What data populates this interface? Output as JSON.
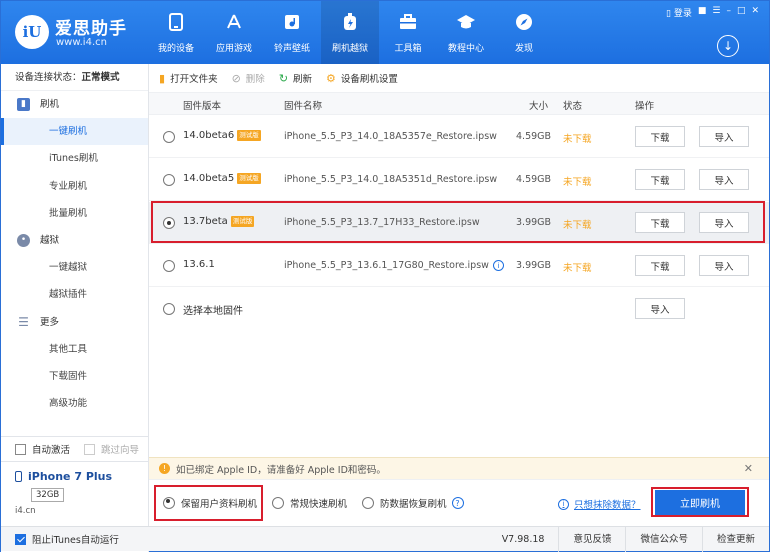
{
  "header": {
    "logo_text": "iU",
    "brand": "爱思助手",
    "site": "www.i4.cn",
    "nav": [
      {
        "label": "我的设备",
        "icon": "phone-icon"
      },
      {
        "label": "应用游戏",
        "icon": "apps-icon"
      },
      {
        "label": "铃声壁纸",
        "icon": "music-icon"
      },
      {
        "label": "刷机越狱",
        "icon": "flash-icon",
        "active": true
      },
      {
        "label": "工具箱",
        "icon": "toolbox-icon"
      },
      {
        "label": "教程中心",
        "icon": "tutorial-icon"
      },
      {
        "label": "发现",
        "icon": "discover-icon"
      }
    ],
    "win_login": "登录"
  },
  "sidebar": {
    "conn_label": "设备连接状态：",
    "conn_value": "正常模式",
    "group_flash": "刷机",
    "items_flash": [
      "一键刷机",
      "iTunes刷机",
      "专业刷机",
      "批量刷机"
    ],
    "group_jailbreak": "越狱",
    "items_jailbreak": [
      "一键越狱",
      "越狱插件"
    ],
    "group_more": "更多",
    "items_more": [
      "其他工具",
      "下载固件",
      "高级功能"
    ],
    "auto_activate": "自动激活",
    "skip_guide": "跳过向导",
    "device_name": "iPhone 7 Plus",
    "capacity": "32GB",
    "device_site": "i4.cn"
  },
  "toolbar": {
    "open_folder": "打开文件夹",
    "delete": "删除",
    "refresh": "刷新",
    "settings": "设备刷机设置"
  },
  "table": {
    "headers": [
      "固件版本",
      "固件名称",
      "大小",
      "状态",
      "操作"
    ],
    "rows": [
      {
        "version": "14.0beta6",
        "tag": "测试版",
        "name": "iPhone_5.5_P3_14.0_18A5357e_Restore.ipsw",
        "size": "4.59GB",
        "status": "未下载",
        "download": "下载",
        "import": "导入"
      },
      {
        "version": "14.0beta5",
        "tag": "测试版",
        "name": "iPhone_5.5_P3_14.0_18A5351d_Restore.ipsw",
        "size": "4.59GB",
        "status": "未下载",
        "download": "下载",
        "import": "导入"
      },
      {
        "version": "13.7beta",
        "tag": "测试版",
        "name": "iPhone_5.5_P3_13.7_17H33_Restore.ipsw",
        "size": "3.99GB",
        "status": "未下载",
        "download": "下载",
        "import": "导入",
        "selected": true
      },
      {
        "version": "13.6.1",
        "tag": "",
        "name": "iPhone_5.5_P3_13.6.1_17G80_Restore.ipsw",
        "size": "3.99GB",
        "status": "未下载",
        "download": "下载",
        "import": "导入"
      }
    ],
    "local_label": "选择本地固件",
    "local_import": "导入"
  },
  "notice": {
    "text": "如已绑定 Apple ID，请准备好 Apple ID和密码。"
  },
  "options": {
    "keep_data": "保留用户资料刷机",
    "quick": "常规快速刷机",
    "anti_recovery": "防数据恢复刷机",
    "erase_link": "只想抹除数据？",
    "flash_now": "立即刷机"
  },
  "footer": {
    "block_itunes": "阻止iTunes自动运行",
    "version": "V7.98.18",
    "feedback": "意见反馈",
    "wechat": "微信公众号",
    "update": "检查更新"
  }
}
